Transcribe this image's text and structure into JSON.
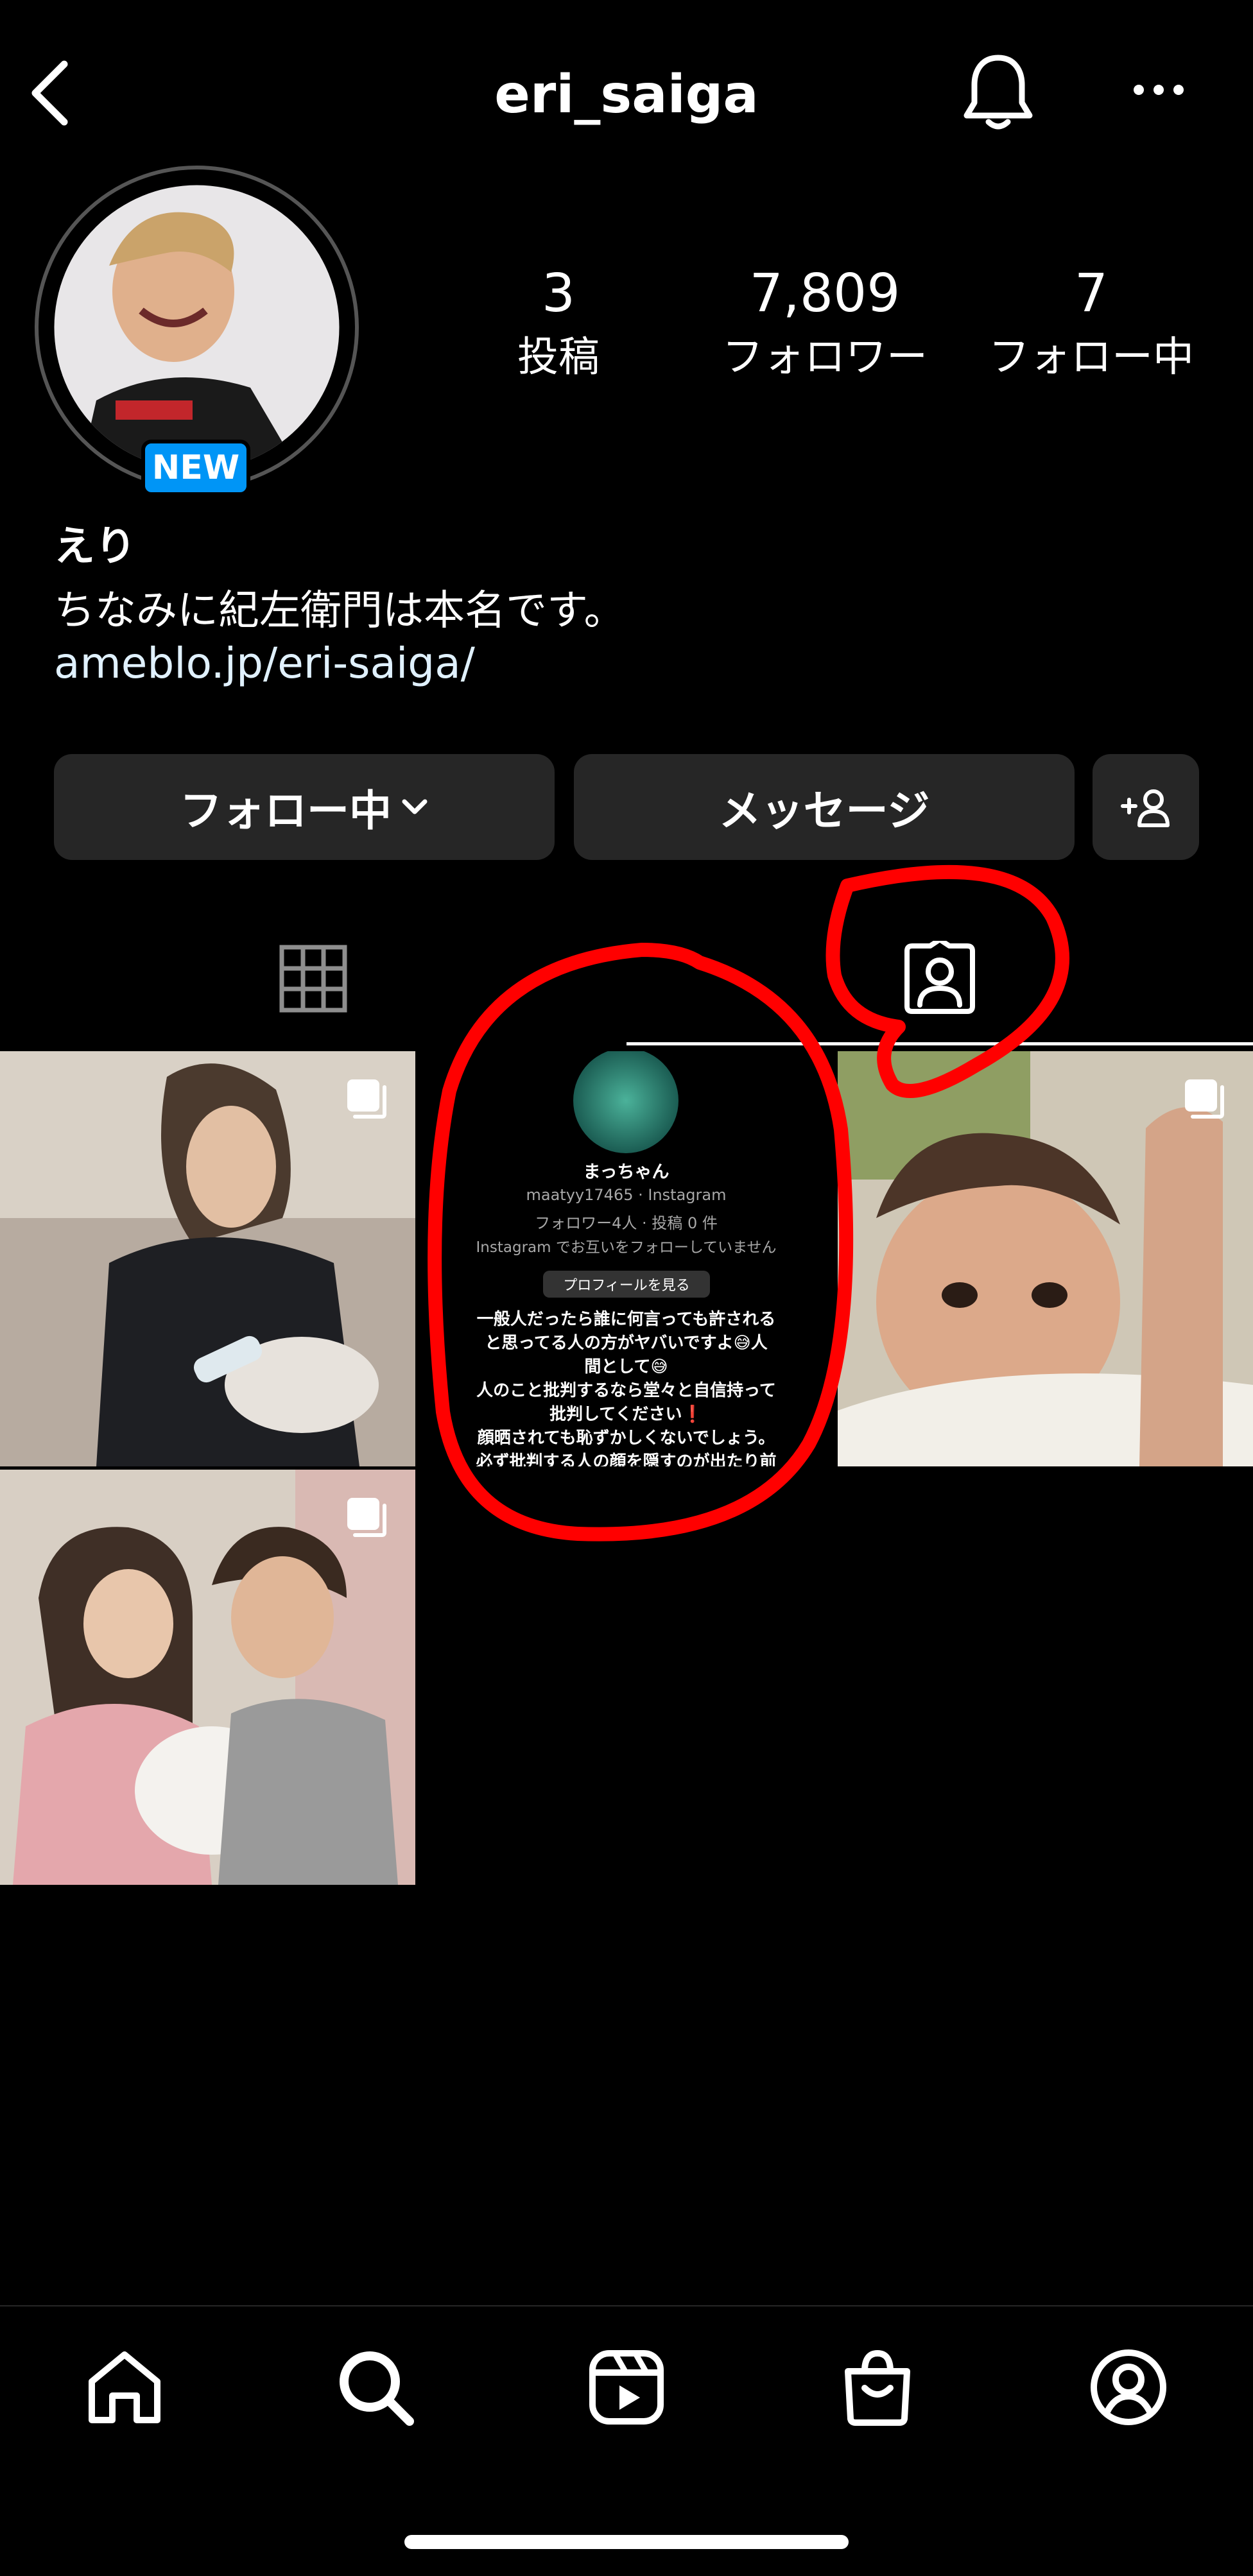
{
  "header": {
    "username": "eri_saiga",
    "back_icon": "chevron-left-icon",
    "bell_icon": "bell-icon",
    "more_icon": "more-horizontal-icon"
  },
  "profile": {
    "new_badge": "NEW",
    "display_name": "えり",
    "bio": "ちなみに紀左衛門は本名です。",
    "link": "ameblo.jp/eri-saiga/",
    "stats": [
      {
        "value": "3",
        "label": "投稿"
      },
      {
        "value": "7,809",
        "label": "フォロワー"
      },
      {
        "value": "7",
        "label": "フォロー中"
      }
    ]
  },
  "actions": {
    "following_label": "フォロー中",
    "message_label": "メッセージ",
    "add_person_icon": "add-person-icon"
  },
  "tabs": {
    "grid_icon": "grid-icon",
    "tagged_icon": "tagged-person-icon",
    "active": "tagged"
  },
  "grid": {
    "tagged_post": {
      "name": "まっちゃん",
      "handle_line": "maatyy17465 · Instagram",
      "meta_line": "フォロワー4人 · 投稿 0 件",
      "mutual_line": "Instagram でお互いをフォローしていません",
      "view_profile": "プロフィールを見る",
      "caption_lines": [
        "一般人だったら誰に何言っても許される",
        "と思ってる人の方がヤバいですよ😅人",
        "間として😅",
        "人のこと批判するなら堂々と自信持って",
        "批判してください❗",
        "顔晒されても恥ずかしくないでしょう。",
        "必ず批判する人の顔を隠すのが出たり前"
      ]
    }
  },
  "bottom_nav": {
    "items": [
      "home-icon",
      "search-icon",
      "reels-icon",
      "shop-icon",
      "profile-icon"
    ]
  },
  "colors": {
    "background": "#000000",
    "button": "#262626",
    "badge": "#0095f6",
    "annotation_red": "#ff0000"
  }
}
